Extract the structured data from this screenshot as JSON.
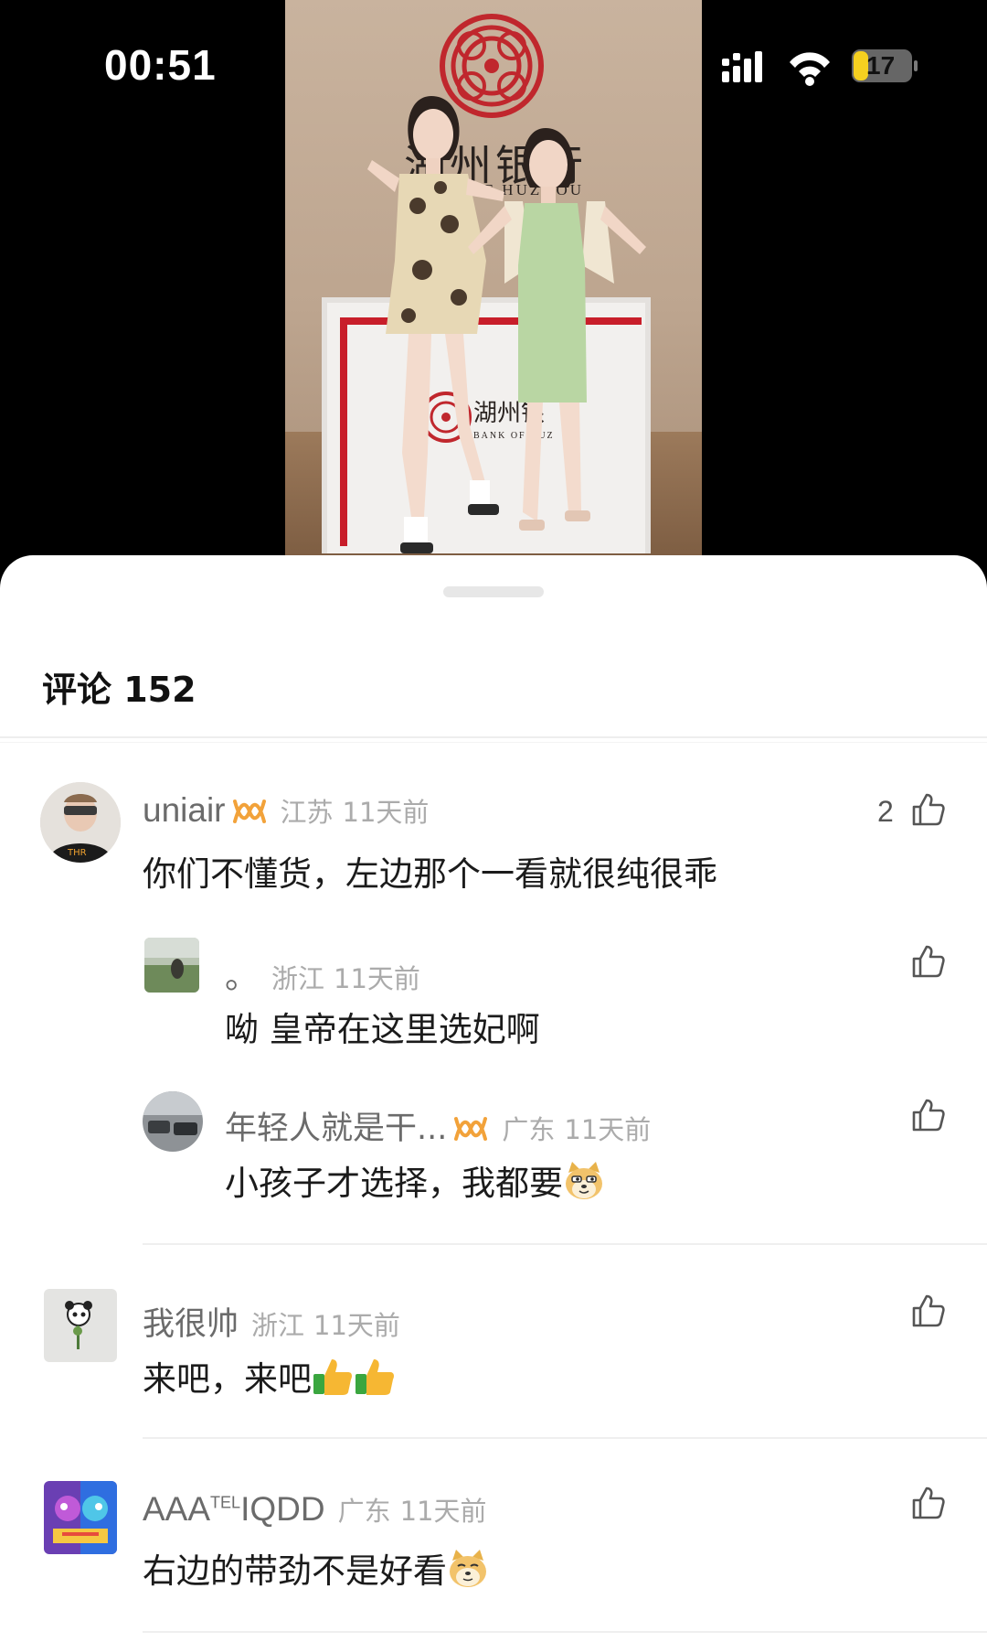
{
  "status_bar": {
    "time": "00:51",
    "battery": "17"
  },
  "video": {
    "bank_name_cn": "湖州银行",
    "bank_name_en": "BANK OF HUZHOU",
    "desk_name_cn": "湖州银",
    "desk_name_en": "BANK OF HUZ"
  },
  "comments_panel": {
    "title": "评论 152",
    "comments": [
      {
        "user": "uniair",
        "location": "江苏",
        "time": "11天前",
        "text": "你们不懂货，左边那个一看就很纯很乖",
        "likes": "2",
        "badge": "vip-badge-icon"
      },
      {
        "user": "。",
        "location": "浙江",
        "time": "11天前",
        "text": "呦 皇帝在这里选妃啊",
        "reply": true
      },
      {
        "user": "年轻人就是干...",
        "location": "广东",
        "time": "11天前",
        "text": "小孩子才选择，我都要",
        "reply": true,
        "badge": "vip-badge-icon",
        "emoji": "doge-emoji"
      },
      {
        "user": "我很帅",
        "location": "浙江",
        "time": "11天前",
        "text": "来吧，来吧",
        "emoji": "thumbs-up-emoji"
      },
      {
        "user": "AAA",
        "user_sup": "TEL",
        "user_suffix": "IQDD",
        "location": "广东",
        "time": "11天前",
        "text": "右边的带劲不是好看",
        "emoji": "doge-emoji"
      }
    ]
  },
  "colors": {
    "sheet_bg": "#ffffff",
    "badge_orange": "#f2a23a",
    "text_primary": "#1b1b1b",
    "text_meta": "#ababab"
  }
}
